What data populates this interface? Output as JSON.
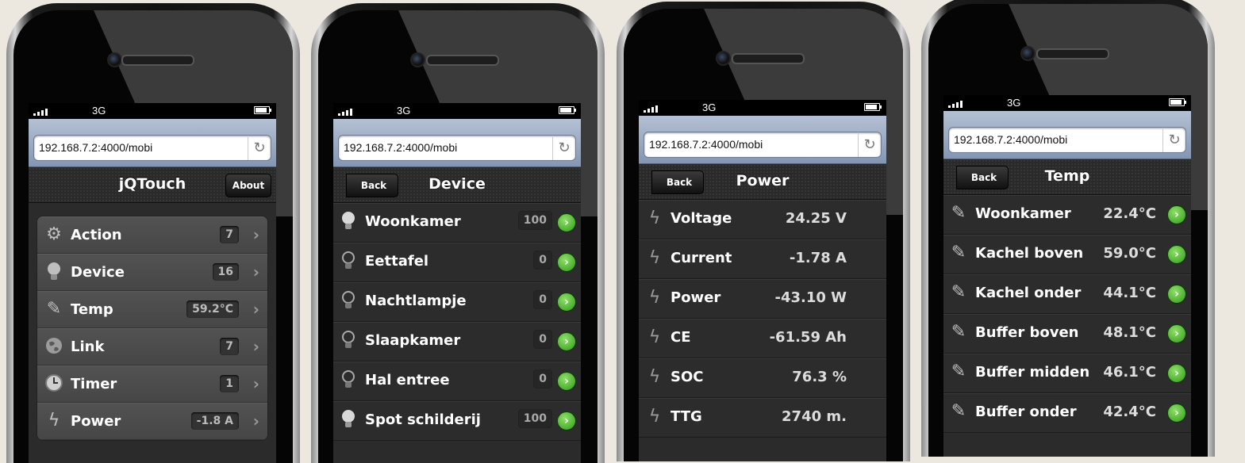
{
  "status": {
    "network": "3G"
  },
  "browser": {
    "url": "192.168.7.2:4000/mobi",
    "reload_icon": "reload-icon"
  },
  "phone1": {
    "title": "jQTouch",
    "about_label": "About",
    "items": [
      {
        "label": "Action",
        "count": "7",
        "icon": "gear-icon"
      },
      {
        "label": "Device",
        "count": "16",
        "icon": "bulb-icon"
      },
      {
        "label": "Temp",
        "count": "59.2°C",
        "icon": "pencil-icon"
      },
      {
        "label": "Link",
        "count": "7",
        "icon": "globe-icon"
      },
      {
        "label": "Timer",
        "count": "1",
        "icon": "clock-icon"
      },
      {
        "label": "Power",
        "count": "-1.8 A",
        "icon": "bolt-icon"
      }
    ]
  },
  "phone2": {
    "title": "Device",
    "back_label": "Back",
    "items": [
      {
        "label": "Woonkamer",
        "dim": "100",
        "on": true
      },
      {
        "label": "Eettafel",
        "dim": "0",
        "on": false
      },
      {
        "label": "Nachtlampje",
        "dim": "0",
        "on": false
      },
      {
        "label": "Slaapkamer",
        "dim": "0",
        "on": false
      },
      {
        "label": "Hal entree",
        "dim": "0",
        "on": false
      },
      {
        "label": "Spot schilderij",
        "dim": "100",
        "on": true
      }
    ]
  },
  "phone3": {
    "title": "Power",
    "back_label": "Back",
    "items": [
      {
        "label": "Voltage",
        "value": "24.25 V"
      },
      {
        "label": "Current",
        "value": "-1.78 A"
      },
      {
        "label": "Power",
        "value": "-43.10 W"
      },
      {
        "label": "CE",
        "value": "-61.59 Ah"
      },
      {
        "label": "SOC",
        "value": "76.3 %"
      },
      {
        "label": "TTG",
        "value": "2740 m."
      }
    ]
  },
  "phone4": {
    "title": "Temp",
    "back_label": "Back",
    "items": [
      {
        "label": "Woonkamer",
        "value": "22.4°C"
      },
      {
        "label": "Kachel boven",
        "value": "59.0°C"
      },
      {
        "label": "Kachel onder",
        "value": "44.1°C"
      },
      {
        "label": "Buffer boven",
        "value": "48.1°C"
      },
      {
        "label": "Buffer midden",
        "value": "46.1°C"
      },
      {
        "label": "Buffer onder",
        "value": "42.4°C"
      }
    ]
  }
}
